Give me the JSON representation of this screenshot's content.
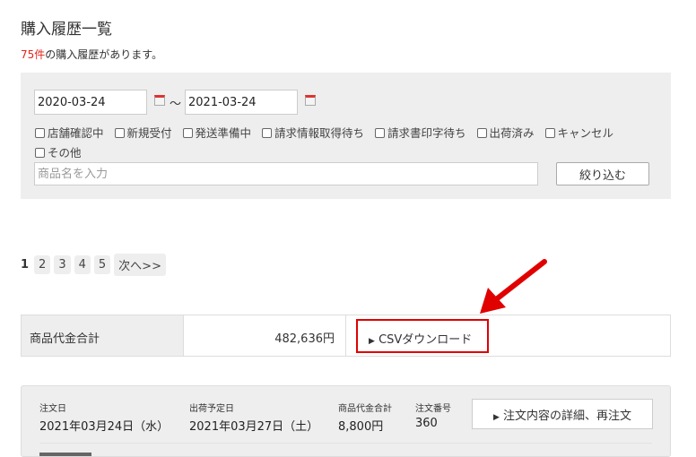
{
  "page": {
    "title": "購入履歴一覧",
    "count_num": "75件",
    "count_text": "の購入履歴があります。"
  },
  "filter": {
    "date_from": "2020-03-24",
    "date_to": "2021-03-24",
    "tilde": "～",
    "statuses": [
      "店舗確認中",
      "新規受付",
      "発送準備中",
      "請求情報取得待ち",
      "請求書印字待ち",
      "出荷済み",
      "キャンセル",
      "その他"
    ],
    "search_placeholder": "商品名を入力",
    "submit_label": "絞り込む"
  },
  "pagination": {
    "current": "1",
    "pages": [
      "2",
      "3",
      "4",
      "5"
    ],
    "next": "次へ>>"
  },
  "summary": {
    "label": "商品代金合計",
    "value": "482,636円",
    "csv_label": "CSVダウンロード"
  },
  "orders": [
    {
      "order_date_label": "注文日",
      "order_date": "2021年03月24日（水）",
      "ship_label": "出荷予定日",
      "ship_date": "2021年03月27日（土）",
      "total_label": "商品代金合計",
      "total": "8,800円",
      "number_label": "注文番号",
      "number": "360",
      "detail_button": "注文内容の詳細、再注文"
    }
  ],
  "colors": {
    "accent": "#e8231a",
    "highlight": "#e00000"
  }
}
